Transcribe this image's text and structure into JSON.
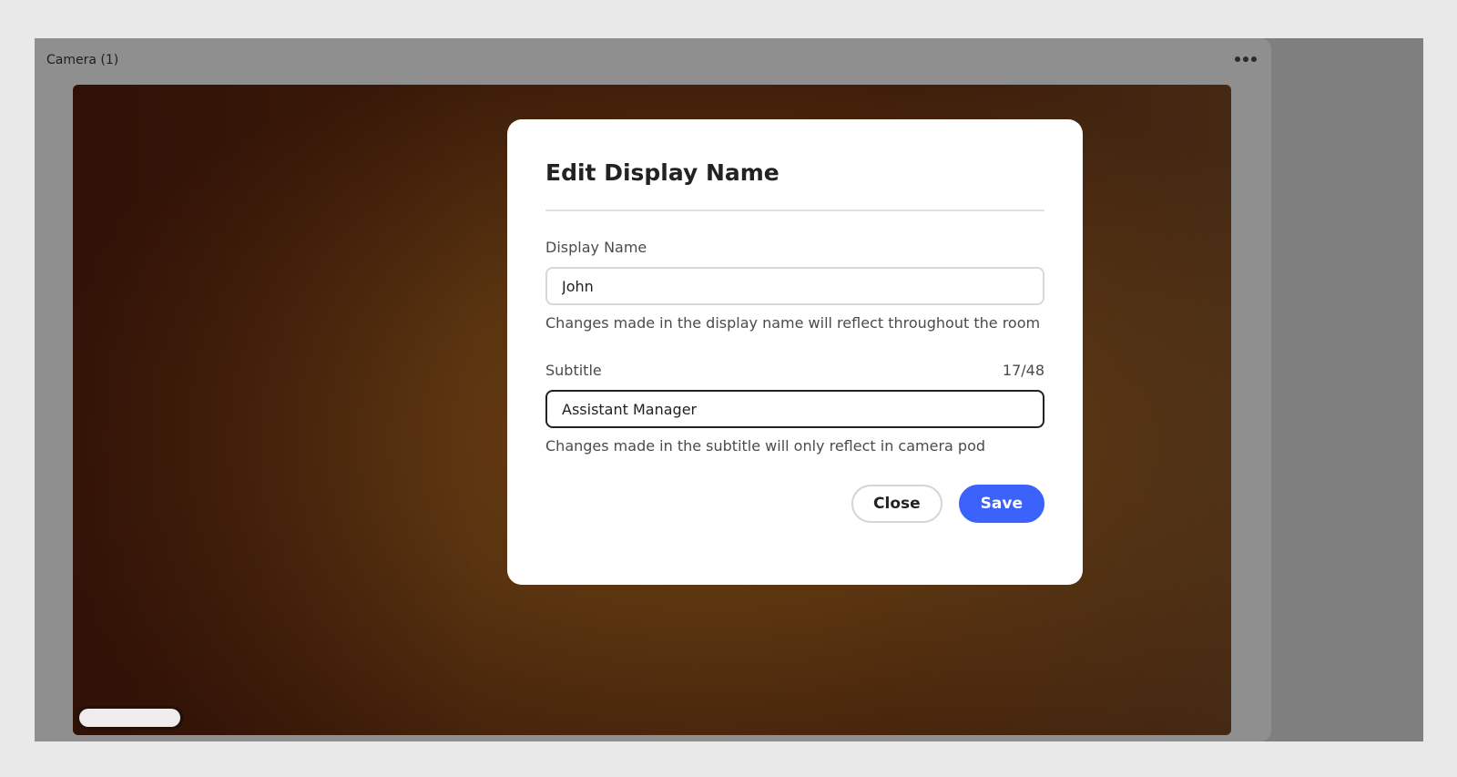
{
  "pod": {
    "title": "Camera (1)",
    "more_icon": "more-horizontal-icon"
  },
  "dialog": {
    "title": "Edit Display Name",
    "display_name": {
      "label": "Display Name",
      "value": "John",
      "help": "Changes made in the display name will reflect throughout the room"
    },
    "subtitle": {
      "label": "Subtitle",
      "counter": "17/48",
      "counter_current": 17,
      "counter_max": 48,
      "value": "Assistant Manager",
      "help": "Changes made in the subtitle will only reflect in camera pod"
    },
    "close_label": "Close",
    "save_label": "Save"
  },
  "colors": {
    "accent": "#3b63fb"
  }
}
